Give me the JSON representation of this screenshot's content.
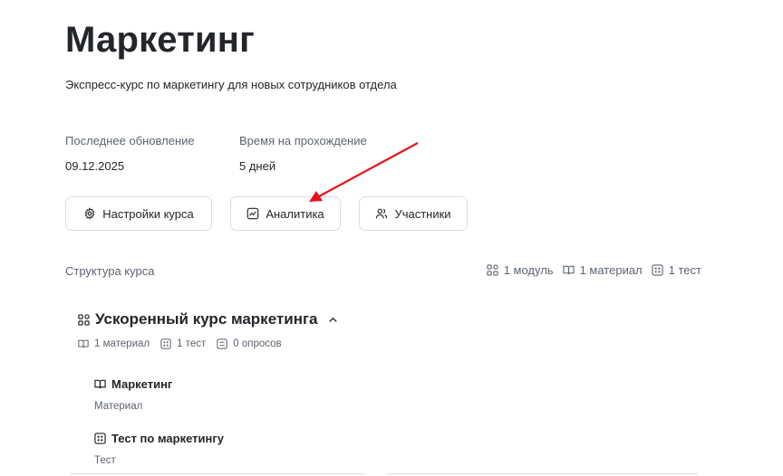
{
  "page": {
    "title": "Маркетинг",
    "subtitle": "Экспресс-курс по маркетингу для новых сотрудников отдела"
  },
  "meta": {
    "updated_label": "Последнее обновление",
    "updated_value": "09.12.2025",
    "duration_label": "Время на прохождение",
    "duration_value": "5 дней"
  },
  "actions": {
    "settings": "Настройки курса",
    "analytics": "Аналитика",
    "participants": "Участники"
  },
  "structure": {
    "label": "Структура курса",
    "modules": "1 модуль",
    "materials": "1 материал",
    "tests": "1 тест"
  },
  "module": {
    "title": "Ускоренный курс маркетинга",
    "materials": "1 материал",
    "tests": "1 тест",
    "surveys": "0 опросов",
    "items": [
      {
        "title": "Маркетинг",
        "type": "Материал",
        "icon": "book-icon"
      },
      {
        "title": "Тест по маркетингу",
        "type": "Тест",
        "icon": "test-icon"
      }
    ]
  },
  "colors": {
    "annotation_arrow": "#e5141c",
    "border": "#dadde3",
    "muted_text": "#5d6470"
  }
}
